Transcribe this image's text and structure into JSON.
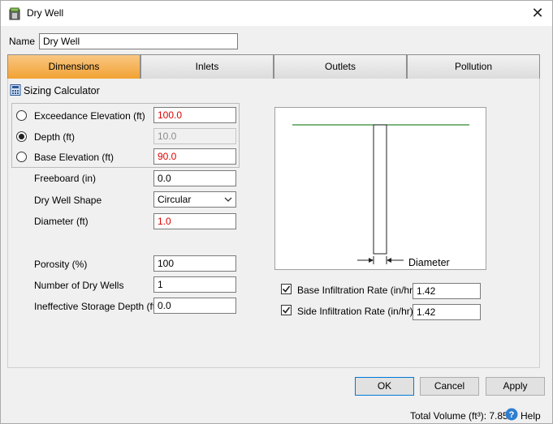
{
  "window": {
    "title": "Dry Well",
    "close_symbol": "✕"
  },
  "name_field": {
    "label": "Name",
    "value": "Dry Well"
  },
  "tabs": [
    {
      "label": "Dimensions",
      "active": true
    },
    {
      "label": "Inlets",
      "active": false
    },
    {
      "label": "Outlets",
      "active": false
    },
    {
      "label": "Pollution",
      "active": false
    }
  ],
  "sizing": {
    "header": "Sizing Calculator",
    "exceedance": {
      "label": "Exceedance Elevation (ft)",
      "value": "100.0",
      "selected": false
    },
    "depth": {
      "label": "Depth (ft)",
      "value": "10.0",
      "selected": true
    },
    "base_elevation": {
      "label": "Base Elevation (ft)",
      "value": "90.0",
      "selected": false
    },
    "freeboard": {
      "label": "Freeboard (in)",
      "value": "0.0"
    },
    "shape": {
      "label": "Dry Well Shape",
      "value": "Circular"
    },
    "diameter": {
      "label": "Diameter (ft)",
      "value": "1.0"
    },
    "porosity": {
      "label": "Porosity (%)",
      "value": "100"
    },
    "num_wells": {
      "label": "Number of Dry Wells",
      "value": "1"
    },
    "ineffective": {
      "label": "Ineffective Storage Depth (ft)",
      "value": "0.0"
    }
  },
  "diagram": {
    "dimension_label": "Diameter"
  },
  "infiltration": {
    "base": {
      "label": "Base Infiltration Rate (in/hr)",
      "value": "1.42",
      "checked": true
    },
    "side": {
      "label": "Side Infiltration Rate (in/hr)",
      "value": "1.42",
      "checked": true
    }
  },
  "buttons": {
    "ok": "OK",
    "cancel": "Cancel",
    "apply": "Apply"
  },
  "footer": {
    "total_volume": "Total Volume (ft³): 7.854",
    "help": "Help"
  },
  "colors": {
    "accent_tab": "#f2a233",
    "error_text": "#e00000",
    "surface_line": "#2e8b2e"
  }
}
